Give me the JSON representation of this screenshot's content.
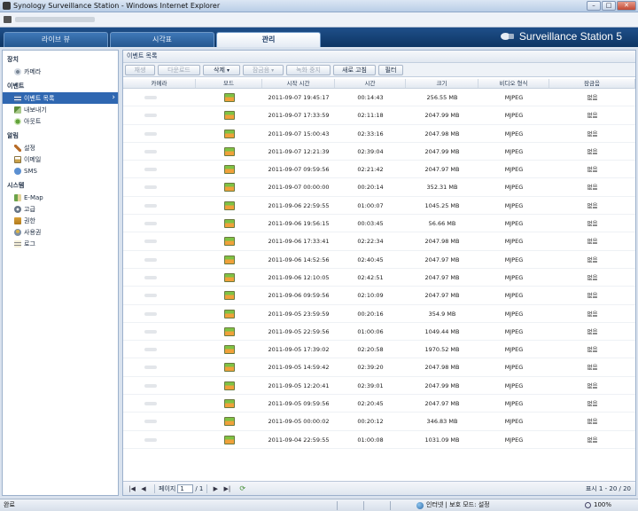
{
  "window": {
    "title": "Synology Surveillance Station - Windows Internet Explorer",
    "controls": {
      "minimize": "–",
      "maximize": "□",
      "close": "✕"
    }
  },
  "header": {
    "tabs": [
      {
        "label": "라이브 뷰"
      },
      {
        "label": "시각표"
      },
      {
        "label": "관리",
        "active": true
      }
    ],
    "brand": "Surveillance Station 5"
  },
  "sidebar": {
    "sections": [
      {
        "title": "장치",
        "items": [
          {
            "label": "카메라",
            "icon": "camera-icon"
          }
        ]
      },
      {
        "title": "이벤트",
        "items": [
          {
            "label": "이벤트 목록",
            "icon": "list-icon",
            "selected": true
          },
          {
            "label": "내보내기",
            "icon": "export-icon"
          },
          {
            "label": "아웃트",
            "icon": "output-icon"
          }
        ]
      },
      {
        "title": "알림",
        "items": [
          {
            "label": "설정",
            "icon": "wrench-icon"
          },
          {
            "label": "이메일",
            "icon": "mail-icon"
          },
          {
            "label": "SMS",
            "icon": "sms-icon"
          }
        ]
      },
      {
        "title": "시스템",
        "items": [
          {
            "label": "E-Map",
            "icon": "map-icon"
          },
          {
            "label": "고급",
            "icon": "advanced-icon"
          },
          {
            "label": "권한",
            "icon": "permission-icon"
          },
          {
            "label": "사용권",
            "icon": "user-icon"
          },
          {
            "label": "로그",
            "icon": "log-icon"
          }
        ]
      }
    ]
  },
  "panel": {
    "title": "이벤트 목록",
    "toolbar": {
      "play": "재생",
      "download": "다운로드",
      "delete": "삭제",
      "lock": "잠금음",
      "stop_record": "녹화 중지",
      "refresh": "새로 고침",
      "filter": "필터"
    },
    "columns": [
      "카메라",
      "모드",
      "시작 시간",
      "시간",
      "크기",
      "비디오 형식",
      "잠금음"
    ],
    "rows": [
      {
        "start": "2011-09-07 19:45:17",
        "dur": "00:14:43",
        "size": "256.55 MB",
        "fmt": "MJPEG",
        "lock": "없음"
      },
      {
        "start": "2011-09-07 17:33:59",
        "dur": "02:11:18",
        "size": "2047.99 MB",
        "fmt": "MJPEG",
        "lock": "없음"
      },
      {
        "start": "2011-09-07 15:00:43",
        "dur": "02:33:16",
        "size": "2047.98 MB",
        "fmt": "MJPEG",
        "lock": "없음"
      },
      {
        "start": "2011-09-07 12:21:39",
        "dur": "02:39:04",
        "size": "2047.99 MB",
        "fmt": "MJPEG",
        "lock": "없음"
      },
      {
        "start": "2011-09-07 09:59:56",
        "dur": "02:21:42",
        "size": "2047.97 MB",
        "fmt": "MJPEG",
        "lock": "없음"
      },
      {
        "start": "2011-09-07 00:00:00",
        "dur": "00:20:14",
        "size": "352.31 MB",
        "fmt": "MJPEG",
        "lock": "없음"
      },
      {
        "start": "2011-09-06 22:59:55",
        "dur": "01:00:07",
        "size": "1045.25 MB",
        "fmt": "MJPEG",
        "lock": "없음"
      },
      {
        "start": "2011-09-06 19:56:15",
        "dur": "00:03:45",
        "size": "56.66 MB",
        "fmt": "MJPEG",
        "lock": "없음"
      },
      {
        "start": "2011-09-06 17:33:41",
        "dur": "02:22:34",
        "size": "2047.98 MB",
        "fmt": "MJPEG",
        "lock": "없음"
      },
      {
        "start": "2011-09-06 14:52:56",
        "dur": "02:40:45",
        "size": "2047.97 MB",
        "fmt": "MJPEG",
        "lock": "없음"
      },
      {
        "start": "2011-09-06 12:10:05",
        "dur": "02:42:51",
        "size": "2047.97 MB",
        "fmt": "MJPEG",
        "lock": "없음"
      },
      {
        "start": "2011-09-06 09:59:56",
        "dur": "02:10:09",
        "size": "2047.97 MB",
        "fmt": "MJPEG",
        "lock": "없음"
      },
      {
        "start": "2011-09-05 23:59:59",
        "dur": "00:20:16",
        "size": "354.9 MB",
        "fmt": "MJPEG",
        "lock": "없음"
      },
      {
        "start": "2011-09-05 22:59:56",
        "dur": "01:00:06",
        "size": "1049.44 MB",
        "fmt": "MJPEG",
        "lock": "없음"
      },
      {
        "start": "2011-09-05 17:39:02",
        "dur": "02:20:58",
        "size": "1970.52 MB",
        "fmt": "MJPEG",
        "lock": "없음"
      },
      {
        "start": "2011-09-05 14:59:42",
        "dur": "02:39:20",
        "size": "2047.98 MB",
        "fmt": "MJPEG",
        "lock": "없음"
      },
      {
        "start": "2011-09-05 12:20:41",
        "dur": "02:39:01",
        "size": "2047.99 MB",
        "fmt": "MJPEG",
        "lock": "없음"
      },
      {
        "start": "2011-09-05 09:59:56",
        "dur": "02:20:45",
        "size": "2047.97 MB",
        "fmt": "MJPEG",
        "lock": "없음"
      },
      {
        "start": "2011-09-05 00:00:02",
        "dur": "00:20:12",
        "size": "346.83 MB",
        "fmt": "MJPEG",
        "lock": "없음"
      },
      {
        "start": "2011-09-04 22:59:55",
        "dur": "01:00:08",
        "size": "1031.09 MB",
        "fmt": "MJPEG",
        "lock": "없음"
      }
    ],
    "pager": {
      "first": "|◀",
      "prev": "◀",
      "page_label": "페이지",
      "page_value": "1",
      "page_total": "/ 1",
      "next": "▶",
      "last": "▶|",
      "summary": "표시 1 - 20 / 20"
    }
  },
  "statusbar": {
    "status": "완료",
    "zone": "인터넷 | 보호 모드: 설정",
    "zoom": "100%"
  },
  "colors": {
    "header_bg": "#0d3563",
    "selected_item": "#2f67b1",
    "mode_icon_top": "#7ec244",
    "mode_icon_bottom": "#f0a13a"
  }
}
